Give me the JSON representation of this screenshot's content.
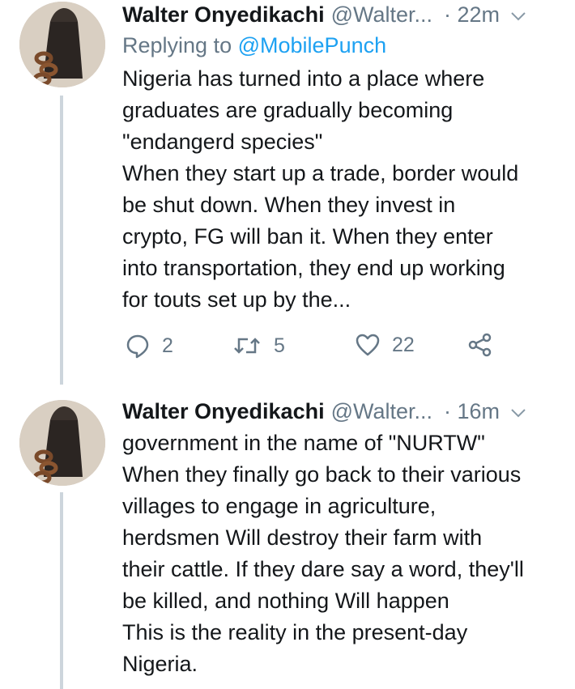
{
  "tweets": [
    {
      "author_name": "Walter Onyedikachi",
      "handle": "@Walter...",
      "time": "· 22m",
      "reply_prefix": "Replying to",
      "reply_to": "@MobilePunch",
      "text": "Nigeria has turned into a place where\ngraduates are gradually becoming\n\"endangerd species\"\nWhen they start up a trade, border would\nbe shut down. When they invest in\ncrypto, FG will ban it. When they enter\ninto transportation, they end up working\nfor touts set up by the...",
      "actions": {
        "replies": "2",
        "retweets": "5",
        "likes": "22"
      }
    },
    {
      "author_name": "Walter Onyedikachi",
      "handle": "@Walter...",
      "time": "· 16m",
      "text": "government in the name of \"NURTW\"\nWhen they finally go back to their various\nvillages to engage in agriculture,\nherdsmen Will destroy their farm with\ntheir cattle. If they dare say a word, they'll\nbe killed, and nothing Will happen\nThis is the reality in the present-day\nNigeria."
    }
  ],
  "colors": {
    "text": "#14171a",
    "secondary": "#657786",
    "link": "#1da1f2",
    "thread_line": "#cdd5dc"
  },
  "icons": [
    "avatar-fist-chain",
    "chevron-down-icon",
    "reply-icon",
    "retweet-icon",
    "like-icon",
    "share-icon"
  ]
}
